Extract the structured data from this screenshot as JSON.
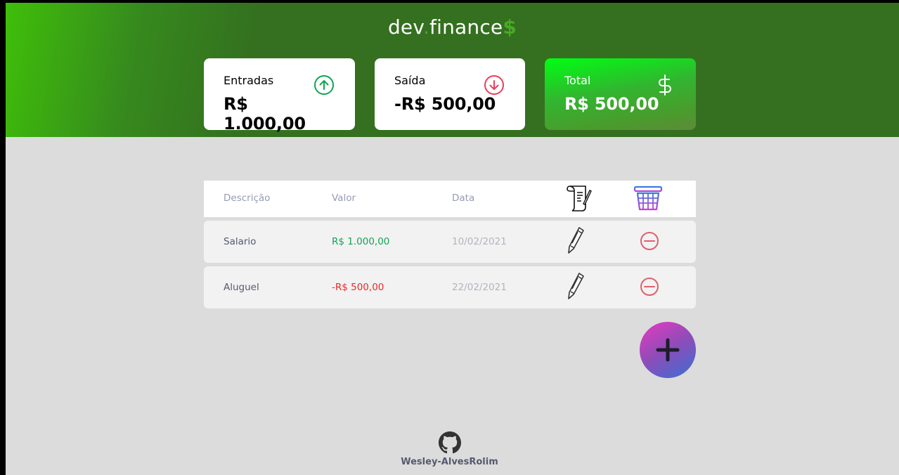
{
  "header": {
    "logo_part1": "dev",
    "logo_dot": ".",
    "logo_part2": "finance",
    "logo_dollar": "$"
  },
  "cards": {
    "income": {
      "label": "Entradas",
      "value": "R$ 1.000,00",
      "icon": "arrow-up-circle-icon"
    },
    "expense": {
      "label": "Saída",
      "value": "-R$ 500,00",
      "icon": "arrow-down-circle-icon"
    },
    "total": {
      "label": "Total",
      "value": "R$ 500,00",
      "icon": "dollar-sign-icon"
    }
  },
  "table": {
    "headers": [
      "Descrição",
      "Valor",
      "Data"
    ],
    "header_icons": [
      "document-icon",
      "basket-icon"
    ],
    "rows": [
      {
        "description": "Salario",
        "amount": "R$ 1.000,00",
        "date": "10/02/2021",
        "type": "income"
      },
      {
        "description": "Aluguel",
        "amount": "-R$ 500,00",
        "date": "22/02/2021",
        "type": "expense"
      }
    ]
  },
  "footer": {
    "github_user": "Wesley-AlvesRolim"
  },
  "colors": {
    "header_green": "#34701f",
    "income_green": "#12a454",
    "expense_red": "#e92929",
    "background": "#dcdcdc"
  }
}
